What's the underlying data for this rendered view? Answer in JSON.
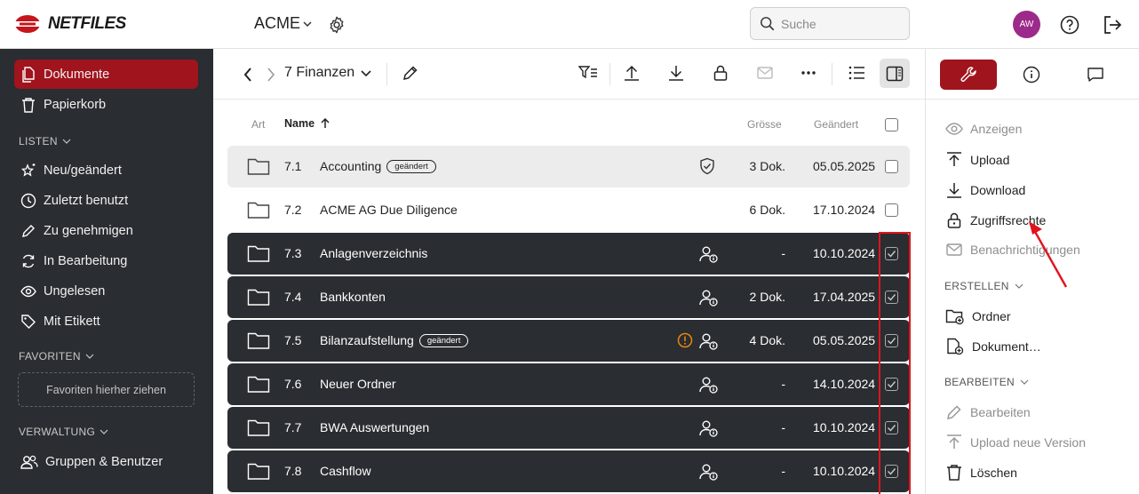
{
  "header": {
    "logo_text": "NETFILES",
    "workspace": "ACME",
    "search_placeholder": "Suche",
    "avatar_initials": "AW"
  },
  "sidebar": {
    "items_top": [
      {
        "label": "Dokumente",
        "icon": "documents-icon",
        "active": true
      },
      {
        "label": "Papierkorb",
        "icon": "trash-icon"
      }
    ],
    "section_lists": "LISTEN",
    "list_items": [
      {
        "label": "Neu/geändert",
        "icon": "sparkle-star-icon"
      },
      {
        "label": "Zuletzt benutzt",
        "icon": "clock-icon"
      },
      {
        "label": "Zu genehmigen",
        "icon": "pencil-icon"
      },
      {
        "label": "In Bearbeitung",
        "icon": "sync-icon"
      },
      {
        "label": "Ungelesen",
        "icon": "eye-icon"
      },
      {
        "label": "Mit Etikett",
        "icon": "tag-icon"
      }
    ],
    "section_favorites": "FAVORITEN",
    "favorites_drop": "Favoriten hierher ziehen",
    "section_admin": "VERWALTUNG",
    "admin_items": [
      {
        "label": "Gruppen & Benutzer",
        "icon": "users-icon"
      }
    ]
  },
  "toolbar": {
    "folder_title": "7 Finanzen"
  },
  "table": {
    "headers": {
      "type": "Art",
      "name": "Name",
      "size": "Grösse",
      "changed": "Geändert"
    },
    "rows": [
      {
        "num": "7.1",
        "name": "Accounting",
        "badge": "geändert",
        "size": "3 Dok.",
        "date": "05.05.2025",
        "state": "hover",
        "flag": "shield",
        "checked": false
      },
      {
        "num": "7.2",
        "name": "ACME AG Due Diligence",
        "badge": "",
        "size": "6 Dok.",
        "date": "17.10.2024",
        "state": "normal",
        "flag": "",
        "checked": false
      },
      {
        "num": "7.3",
        "name": "Anlagenverzeichnis",
        "badge": "",
        "size": "-",
        "date": "10.10.2024",
        "state": "selected",
        "flag": "share",
        "checked": true
      },
      {
        "num": "7.4",
        "name": "Bankkonten",
        "badge": "",
        "size": "2 Dok.",
        "date": "17.04.2025",
        "state": "selected",
        "flag": "share",
        "checked": true
      },
      {
        "num": "7.5",
        "name": "Bilanzaufstellung",
        "badge": "geändert",
        "size": "4 Dok.",
        "date": "05.05.2025",
        "state": "selected",
        "flag": "share",
        "warn": true,
        "checked": true
      },
      {
        "num": "7.6",
        "name": "Neuer Ordner",
        "badge": "",
        "size": "-",
        "date": "14.10.2024",
        "state": "selected",
        "flag": "share",
        "checked": true
      },
      {
        "num": "7.7",
        "name": "BWA Auswertungen",
        "badge": "",
        "size": "-",
        "date": "10.10.2024",
        "state": "selected",
        "flag": "share",
        "checked": true
      },
      {
        "num": "7.8",
        "name": "Cashflow",
        "badge": "",
        "size": "-",
        "date": "10.10.2024",
        "state": "selected",
        "flag": "share",
        "checked": true
      }
    ]
  },
  "right_panel": {
    "actions": [
      {
        "label": "Anzeigen",
        "icon": "eye-icon",
        "disabled": true
      },
      {
        "label": "Upload",
        "icon": "upload-icon",
        "disabled": false
      },
      {
        "label": "Download",
        "icon": "download-icon",
        "disabled": false
      },
      {
        "label": "Zugriffsrechte",
        "icon": "lock-icon",
        "disabled": false
      },
      {
        "label": "Benachrichtigungen",
        "icon": "mail-icon",
        "disabled": true
      }
    ],
    "section_create": "ERSTELLEN",
    "create_items": [
      {
        "label": "Ordner",
        "icon": "folder-plus-icon"
      },
      {
        "label": "Dokument…",
        "icon": "file-plus-icon"
      }
    ],
    "section_edit": "BEARBEITEN",
    "edit_items": [
      {
        "label": "Bearbeiten",
        "icon": "pencil-icon",
        "disabled": true
      },
      {
        "label": "Upload neue Version",
        "icon": "upload-icon",
        "disabled": true
      },
      {
        "label": "Löschen",
        "icon": "trash-icon",
        "disabled": false
      }
    ]
  },
  "colors": {
    "brand_red": "#a0141d",
    "sidebar_bg": "#2a2d31",
    "highlight_red": "#e0141e",
    "warning_orange": "#e8860f"
  }
}
